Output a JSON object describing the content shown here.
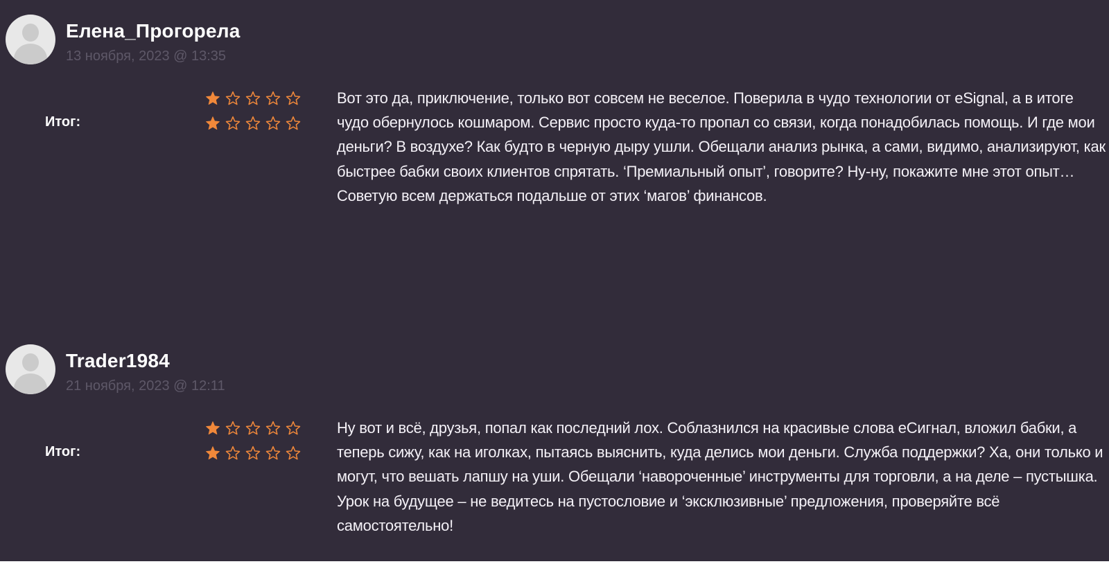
{
  "reviews": [
    {
      "author": "Елена_Прогорела",
      "date": "13 ноября, 2023 @ 13:35",
      "rating_label": "Итог:",
      "ratings": [
        1,
        1
      ],
      "max_rating": 5,
      "text": "Вот это да, приключение, только вот совсем не веселое. Поверила в чудо технологии от eSignal, а в итоге чудо обернулось кошмаром. Сервис просто куда-то пропал со связи, когда понадобилась помощь. И где мои деньги? В воздухе? Как будто в черную дыру ушли. Обещали анализ рынка, а сами, видимо, анализируют, как быстрее бабки своих клиентов спрятать. ‘Премиальный опыт’, говорите? Ну-ну, покажите мне этот опыт… Советую всем держаться подальше от этих ‘магов’ финансов."
    },
    {
      "author": "Trader1984",
      "date": "21 ноября, 2023 @ 12:11",
      "rating_label": "Итог:",
      "ratings": [
        1,
        1
      ],
      "max_rating": 5,
      "text": "Ну вот и всё, друзья, попал как последний лох. Соблазнился на красивые слова еСигнал, вложил бабки, а теперь сижу, как на иголках, пытаясь выяснить, куда делись мои деньги. Служба поддержки? Ха, они только и могут, что вешать лапшу на уши. Обещали ‘навороченные’ инструменты для торговли, а на деле – пустышка. Урок на будущее – не ведитесь на пустословие и ‘эксклюзивные’ предложения, проверяйте всё самостоятельно!"
    }
  ],
  "icons": {
    "avatar": "default-user-avatar-icon",
    "star_filled": "star-filled-icon",
    "star_empty": "star-outline-icon"
  },
  "colors": {
    "background": "#322c3a",
    "star": "#f0883a",
    "date": "#5e5868",
    "text": "#f4f1f7"
  }
}
